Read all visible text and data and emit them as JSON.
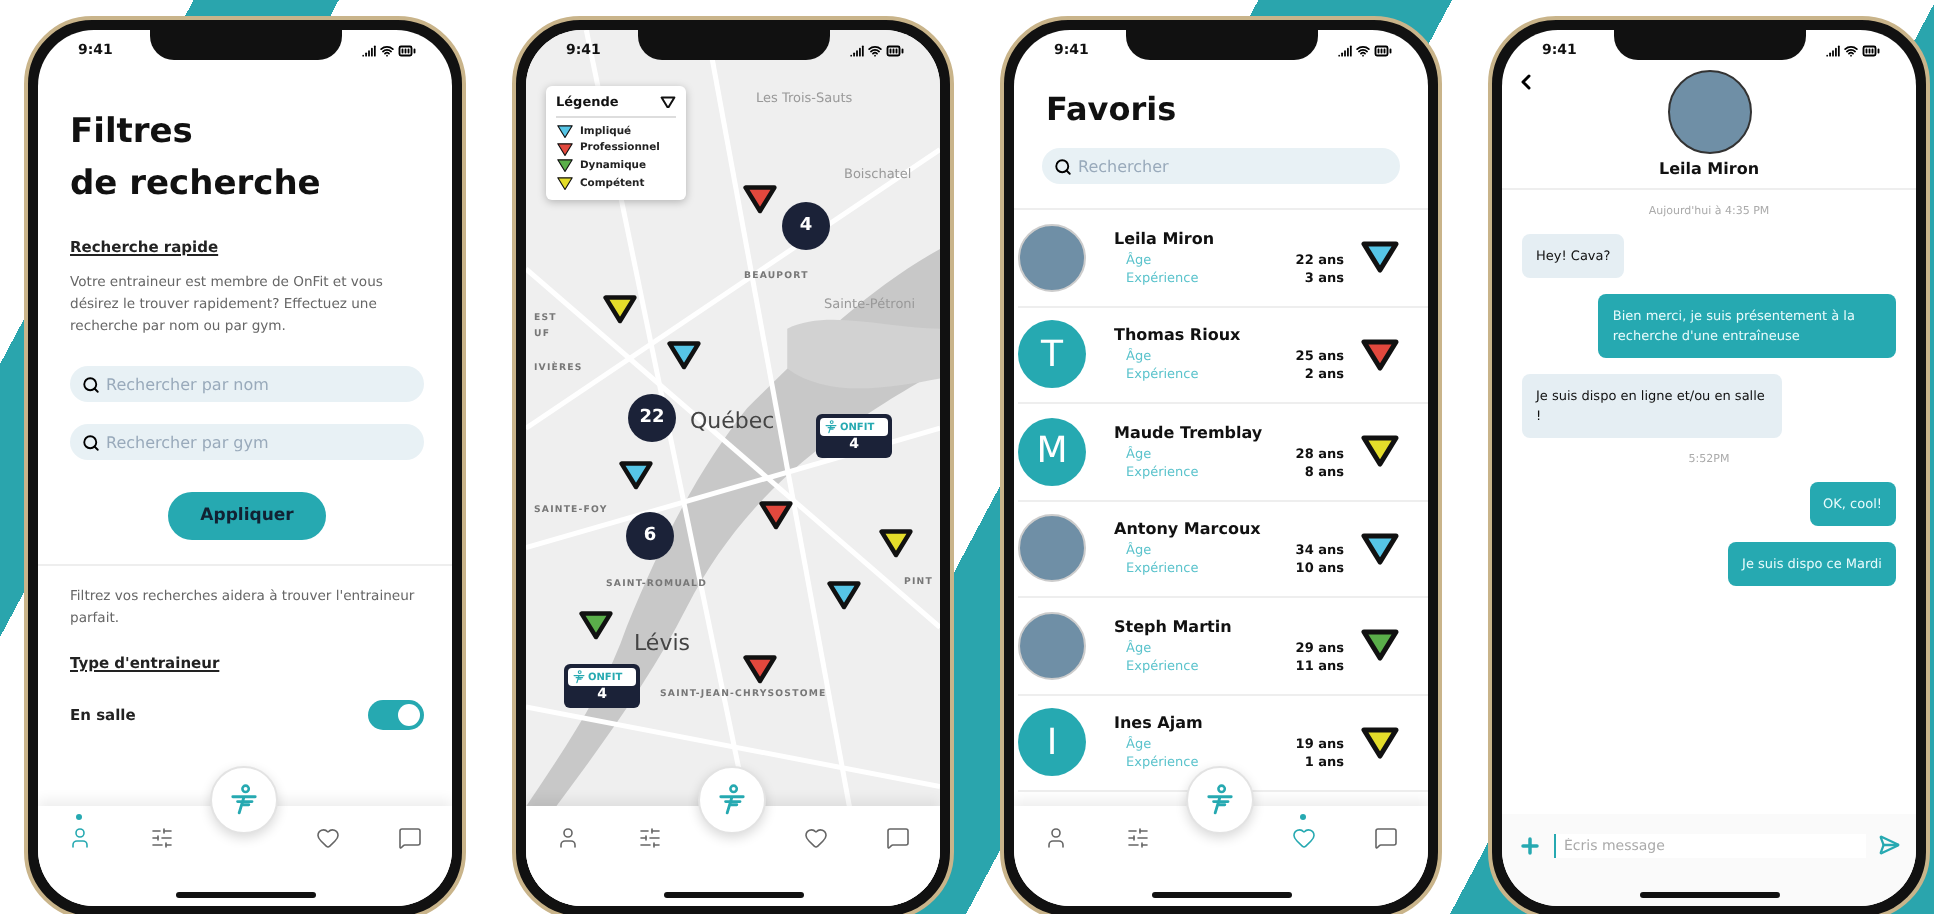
{
  "phones": [
    {
      "kind": "filters",
      "status_time": "9:41",
      "title_lines": [
        "Filtres",
        "de recherche"
      ],
      "quick_heading": "Recherche rapide",
      "quick_text": "Votre entraineur est membre de OnFit et vous désirez le trouver rapidement? Effectuez une recherche par nom ou par gym.",
      "searches": [
        {
          "placeholder": "Rechercher par nom"
        },
        {
          "placeholder": "Rechercher par gym"
        }
      ],
      "apply_button": "Appliquer",
      "filter_text": "Filtrez vos recherches aidera à trouver l'entraineur parfait.",
      "type_heading": "Type d'entraineur",
      "toggles": [
        {
          "label": "En salle",
          "on": true
        }
      ],
      "nav": [
        {
          "kind": "profile",
          "selected": true
        },
        {
          "kind": "filters",
          "selected": false
        },
        {
          "kind": "favorites",
          "selected": false
        },
        {
          "kind": "messages",
          "selected": false
        }
      ]
    },
    {
      "kind": "map",
      "status_time": "9:41",
      "legend": {
        "title": "Légende",
        "items": [
          {
            "label": "Impliqué",
            "color": "#56c5e6"
          },
          {
            "label": "Professionnel",
            "color": "#e2483d"
          },
          {
            "label": "Dynamique",
            "color": "#5aaf4a"
          },
          {
            "label": "Compétent",
            "color": "#e4dd2a"
          }
        ]
      },
      "places": [
        {
          "name": "Les Trois-Sauts",
          "kind": "town"
        },
        {
          "name": "Boischatel",
          "kind": "town"
        },
        {
          "name": "BEAUPORT",
          "kind": "district"
        },
        {
          "name": "Sainte-Pétroni",
          "kind": "town"
        },
        {
          "name": "EST",
          "kind": "district"
        },
        {
          "name": "UF",
          "kind": "district"
        },
        {
          "name": "IVIÈRES",
          "kind": "district"
        },
        {
          "name": "Québec",
          "kind": "city"
        },
        {
          "name": "SAINTE-FOY",
          "kind": "district"
        },
        {
          "name": "SAINT-ROMUALD",
          "kind": "district"
        },
        {
          "name": "PINT",
          "kind": "district"
        },
        {
          "name": "Lévis",
          "kind": "city"
        },
        {
          "name": "SAINT-JEAN-CHRYSOSTOME",
          "kind": "district"
        }
      ],
      "markers": [
        {
          "kind": "trainer",
          "color": "#e2483d"
        },
        {
          "kind": "cluster",
          "count": "4"
        },
        {
          "kind": "trainer",
          "color": "#e4dd2a"
        },
        {
          "kind": "trainer",
          "color": "#56c5e6"
        },
        {
          "kind": "cluster",
          "count": "22"
        },
        {
          "kind": "gym",
          "label": "ONFIT",
          "count": "4"
        },
        {
          "kind": "trainer",
          "color": "#56c5e6"
        },
        {
          "kind": "cluster",
          "count": "6"
        },
        {
          "kind": "trainer",
          "color": "#e2483d"
        },
        {
          "kind": "trainer",
          "color": "#e4dd2a"
        },
        {
          "kind": "trainer",
          "color": "#56c5e6"
        },
        {
          "kind": "trainer",
          "color": "#5aaf4a"
        },
        {
          "kind": "trainer",
          "color": "#e2483d"
        },
        {
          "kind": "gym",
          "label": "ONFIT",
          "count": "4"
        }
      ],
      "nav": [
        {
          "kind": "profile",
          "selected": false
        },
        {
          "kind": "filters",
          "selected": false
        },
        {
          "kind": "favorites",
          "selected": false
        },
        {
          "kind": "messages",
          "selected": false
        }
      ]
    },
    {
      "kind": "favorites",
      "status_time": "9:41",
      "title": "Favoris",
      "search": {
        "placeholder": "Rechercher"
      },
      "trainers": [
        {
          "name": "Leila Miron",
          "kind": "photo",
          "age_label": "Âge",
          "age": "22 ans",
          "experience_label": "Expérience",
          "experience": "3 ans",
          "color": "#56c5e6"
        },
        {
          "name": "Thomas Rioux",
          "kind": "initial",
          "initial": "T",
          "age_label": "Âge",
          "age": "25 ans",
          "experience_label": "Expérience",
          "experience": "2 ans",
          "color": "#e2483d"
        },
        {
          "name": "Maude Tremblay",
          "kind": "initial",
          "initial": "M",
          "age_label": "Âge",
          "age": "28 ans",
          "experience_label": "Expérience",
          "experience": "8 ans",
          "color": "#e4dd2a"
        },
        {
          "name": "Antony Marcoux",
          "kind": "photo",
          "age_label": "Âge",
          "age": "34 ans",
          "experience_label": "Expérience",
          "experience": "10 ans",
          "color": "#56c5e6"
        },
        {
          "name": "Steph Martin",
          "kind": "photo",
          "age_label": "Âge",
          "age": "29 ans",
          "experience_label": "Expérience",
          "experience": "11 ans",
          "color": "#5aaf4a"
        },
        {
          "name": "Ines Ajam",
          "kind": "initial",
          "initial": "I",
          "age_label": "Âge",
          "age": "19 ans",
          "experience_label": "Expérience",
          "experience": "1 ans",
          "color": "#e4dd2a"
        }
      ],
      "nav": [
        {
          "kind": "profile",
          "selected": false
        },
        {
          "kind": "filters",
          "selected": false
        },
        {
          "kind": "favorites",
          "selected": true
        },
        {
          "kind": "messages",
          "selected": false
        }
      ]
    },
    {
      "kind": "chat",
      "status_time": "9:41",
      "contact": "Leila Miron",
      "messages": [
        {
          "kind": "time",
          "text": "Aujourd'hui à 4:35 PM"
        },
        {
          "kind": "received",
          "text": "Hey! Cava?"
        },
        {
          "kind": "sent",
          "text": "Bien merci, je suis présentement à la recherche d'une entraîneuse"
        },
        {
          "kind": "received",
          "text": "Je suis dispo en ligne et/ou en salle !"
        },
        {
          "kind": "time",
          "text": "5:52PM"
        },
        {
          "kind": "sent",
          "text": "OK, cool!"
        },
        {
          "kind": "sent",
          "text": "Je suis dispo ce Mardi"
        }
      ],
      "composer": {
        "placeholder": "Écris message"
      }
    }
  ]
}
